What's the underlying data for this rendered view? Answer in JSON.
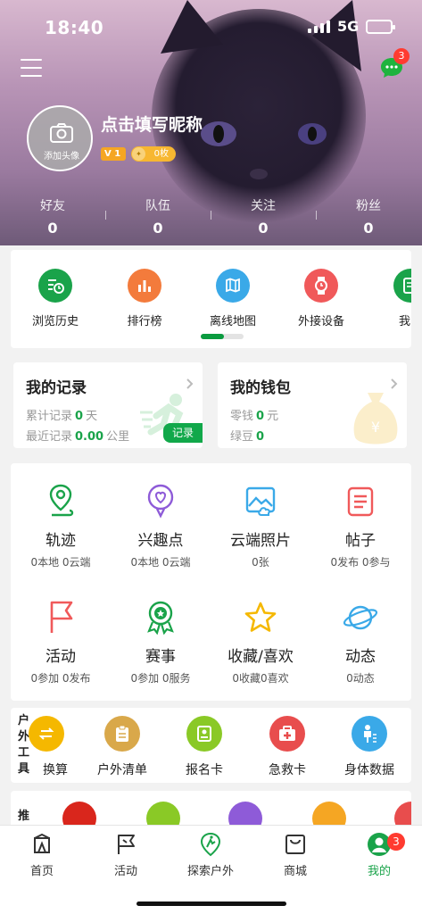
{
  "status_bar": {
    "time": "18:40",
    "network": "5G"
  },
  "header": {
    "message_badge": "3",
    "avatar_label": "添加头像",
    "nickname": "点击填写昵称",
    "level_badge": "V 1",
    "coin_badge": "0枚",
    "stats": [
      {
        "label": "好友",
        "value": "0"
      },
      {
        "label": "队伍",
        "value": "0"
      },
      {
        "label": "关注",
        "value": "0"
      },
      {
        "label": "粉丝",
        "value": "0"
      }
    ]
  },
  "quick_tools": {
    "items": [
      {
        "label": "浏览历史",
        "icon": "history-icon",
        "color": "#1aa34a"
      },
      {
        "label": "排行榜",
        "icon": "ranking-icon",
        "color": "#f37b3c"
      },
      {
        "label": "离线地图",
        "icon": "offline-map-icon",
        "color": "#3aa9e8"
      },
      {
        "label": "外接设备",
        "icon": "watch-icon",
        "color": "#f0595a"
      },
      {
        "label": "我的",
        "icon": "doc-icon",
        "color": "#1aa34a"
      }
    ],
    "page_progress": 0.55
  },
  "my_records": {
    "title": "我的记录",
    "rows": [
      {
        "label": "累计记录",
        "value": "0",
        "unit": "天"
      },
      {
        "label": "最近记录",
        "value": "0.00",
        "unit": "公里"
      }
    ],
    "button": "记录"
  },
  "my_wallet": {
    "title": "我的钱包",
    "rows": [
      {
        "label": "零钱",
        "value": "0",
        "unit": "元"
      },
      {
        "label": "绿豆",
        "value": "0",
        "unit": ""
      }
    ]
  },
  "grid": [
    {
      "title": "轨迹",
      "sub": "0本地 0云端",
      "icon": "track-icon",
      "color": "#1aa34a"
    },
    {
      "title": "兴趣点",
      "sub": "0本地 0云端",
      "icon": "heart-pin-icon",
      "color": "#8e5bd8"
    },
    {
      "title": "云端照片",
      "sub": "0张",
      "icon": "cloud-photo-icon",
      "color": "#3aa9e8"
    },
    {
      "title": "帖子",
      "sub": "0发布 0参与",
      "icon": "post-icon",
      "color": "#f0595a"
    },
    {
      "title": "活动",
      "sub": "0参加 0发布",
      "icon": "flag-icon",
      "color": "#f0595a"
    },
    {
      "title": "赛事",
      "sub": "0参加 0服务",
      "icon": "medal-icon",
      "color": "#1aa34a"
    },
    {
      "title": "收藏/喜欢",
      "sub": "0收藏0喜欢",
      "icon": "star-icon",
      "color": "#f5b800"
    },
    {
      "title": "动态",
      "sub": "0动态",
      "icon": "planet-icon",
      "color": "#3aa9e8"
    }
  ],
  "outdoor_tools": {
    "label": "户外工具",
    "items": [
      {
        "label": "换算",
        "icon": "convert-icon",
        "color": "#f5b800"
      },
      {
        "label": "户外清单",
        "icon": "checklist-icon",
        "color": "#d9a84a"
      },
      {
        "label": "报名卡",
        "icon": "signup-card-icon",
        "color": "#8ac926"
      },
      {
        "label": "急救卡",
        "icon": "firstaid-icon",
        "color": "#e84d4d"
      },
      {
        "label": "身体数据",
        "icon": "body-data-icon",
        "color": "#3aa9e8"
      }
    ]
  },
  "recommend": {
    "label": "推"
  },
  "tabbar": {
    "tabs": [
      {
        "label": "首页",
        "icon": "home-icon"
      },
      {
        "label": "活动",
        "icon": "activity-flag-icon"
      },
      {
        "label": "探索户外",
        "icon": "explore-icon"
      },
      {
        "label": "商城",
        "icon": "mall-icon"
      },
      {
        "label": "我的",
        "icon": "me-icon"
      }
    ],
    "me_badge": "3"
  }
}
